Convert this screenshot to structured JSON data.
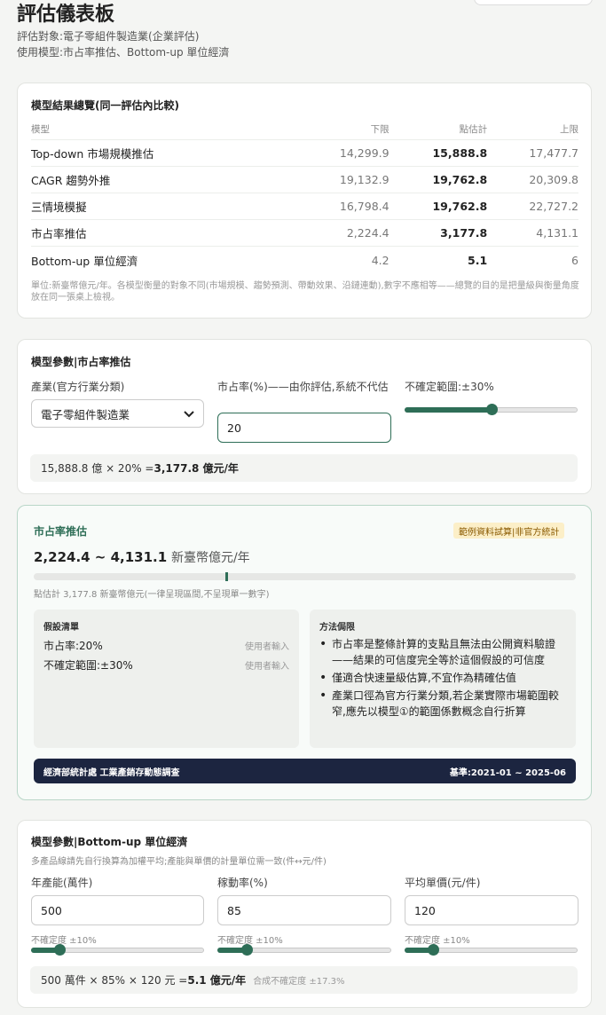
{
  "page": {
    "title": "評估儀表板",
    "subject": "評估對象:電子零組件製造業(企業評估)",
    "models_used": "使用模型:市占率推估、Bottom-up 單位經濟"
  },
  "summary": {
    "title": "模型結果總覽(同一評估內比較)",
    "headers": [
      "模型",
      "下限",
      "點估計",
      "上限"
    ],
    "rows": [
      {
        "model": "Top-down 市場規模推估",
        "low": "14,299.9",
        "point": "15,888.8",
        "high": "17,477.7"
      },
      {
        "model": "CAGR 趨勢外推",
        "low": "19,132.9",
        "point": "19,762.8",
        "high": "20,309.8"
      },
      {
        "model": "三情境模擬",
        "low": "16,798.4",
        "point": "19,762.8",
        "high": "22,727.2"
      },
      {
        "model": "市占率推估",
        "low": "2,224.4",
        "point": "3,177.8",
        "high": "4,131.1"
      },
      {
        "model": "Bottom-up 單位經濟",
        "low": "4.2",
        "point": "5.1",
        "high": "6"
      }
    ],
    "note": "單位:新臺幣億元/年。各模型衡量的對象不同(市場規模、趨勢預測、帶動效果、沿鏈連動),數字不應相等——總覽的目的是把量級與衡量角度放在同一張桌上檢視。"
  },
  "share_params": {
    "title": "模型參數|市占率推估",
    "industry_label": "產業(官方行業分類)",
    "industry_value": "電子零組件製造業",
    "share_label": "市占率(%)——由你評估,系統不代估",
    "share_value": "20",
    "uncertainty_label": "不確定範圍:±30%",
    "uncertainty_pct": 30,
    "uncertainty_max": 60,
    "formula_text": "15,888.8 億 × 20% = ",
    "formula_result": "3,177.8 億元/年"
  },
  "result": {
    "title": "市占率推估",
    "badge": "範例資料試算|非官方統計",
    "range_text": "2,224.4 ~ 4,131.1",
    "range_unit": "新臺幣億元/年",
    "point_value": 3177.8,
    "bar_max": 9000,
    "point_note": "點估計 3,177.8 新臺幣億元(一律呈現區間,不呈現單一數字)",
    "assumptions_title": "假設清單",
    "assumptions": [
      {
        "key": "市占率:20%",
        "source": "使用者輸入"
      },
      {
        "key": "不確定範圍:±30%",
        "source": "使用者輸入"
      }
    ],
    "limits_title": "方法侷限",
    "limits": [
      "市占率是整條計算的支點且無法由公開資料驗證——結果的可信度完全等於這個假設的可信度",
      "僅適合快速量級估算,不宜作為精確估值",
      "產業口徑為官方行業分類,若企業實際市場範圍較窄,應先以模型①的範圍係數概念自行折算"
    ],
    "source_name": "經濟部統計處 工業產銷存動態調查",
    "source_period": "基準:2021-01 ~ 2025-06"
  },
  "bottomup": {
    "title": "模型參數|Bottom-up 單位經濟",
    "hint": "多產品線請先自行換算為加權平均;產能與單價的計量單位需一致(件↔元/件)",
    "fields": [
      {
        "label": "年產能(萬件)",
        "value": "500",
        "unc_label": "不確定度 ±10%",
        "unc_pct": 10
      },
      {
        "label": "稼動率(%)",
        "value": "85",
        "unc_label": "不確定度 ±10%",
        "unc_pct": 10
      },
      {
        "label": "平均單價(元/件)",
        "value": "120",
        "unc_label": "不確定度 ±10%",
        "unc_pct": 10
      }
    ],
    "unc_max": 60,
    "formula_text": "500 萬件 × 85% × 120 元 = ",
    "formula_result": "5.1 億元/年",
    "formula_extra": "合成不確定度 ±17.3%"
  }
}
